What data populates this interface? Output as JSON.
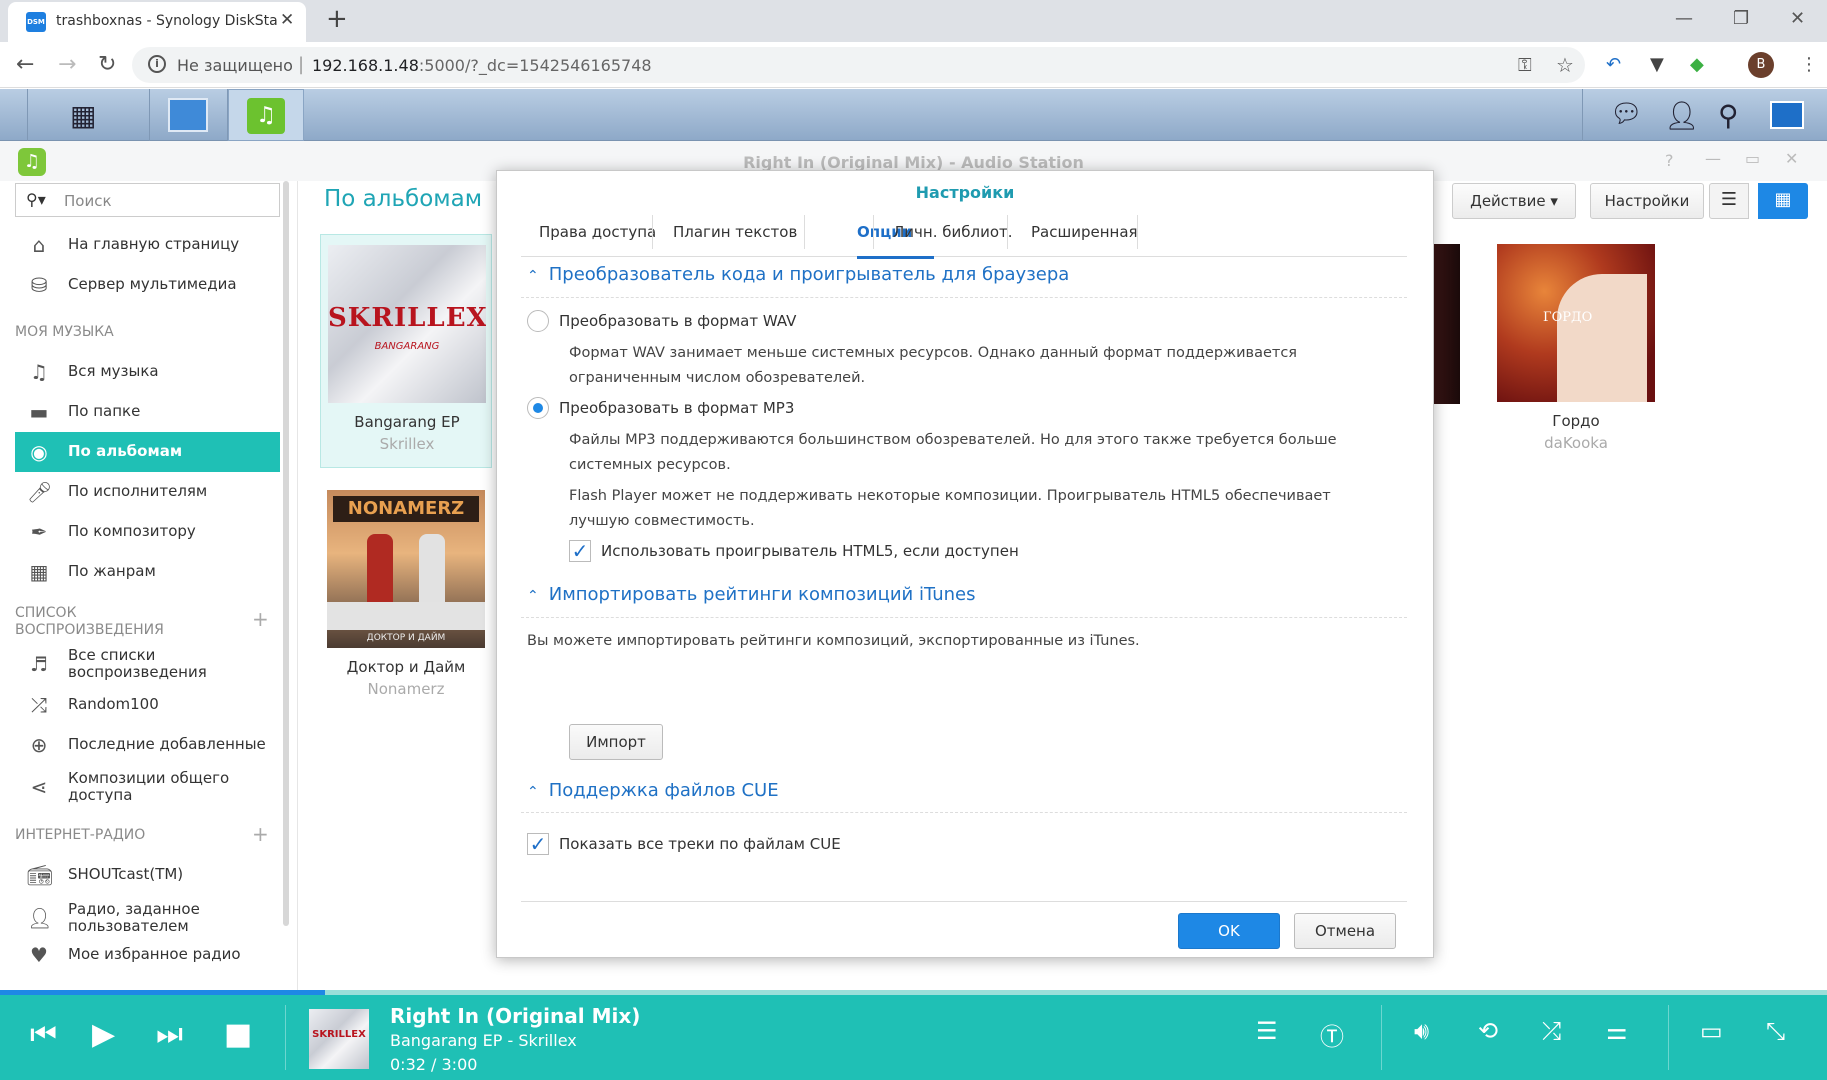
{
  "browser": {
    "tab_title": "trashboxnas - Synology DiskStation",
    "tab_favicon": "DSM",
    "security_label": "Не защищено",
    "url_host": "192.168.1.48",
    "url_rest": ":5000/?_dc=1542546165748",
    "avatar_letter": "B"
  },
  "window": {
    "title": "Right In (Original Mix) - Audio Station"
  },
  "sidebar": {
    "search_placeholder": "Поиск",
    "items_top": [
      {
        "label": "На главную страницу",
        "icon": "home-icon"
      },
      {
        "label": "Сервер мультимедиа",
        "icon": "media-server-icon"
      }
    ],
    "my_music_header": "МОЯ МУЗЫКА",
    "my_music": [
      {
        "label": "Вся музыка",
        "icon": "music-note-icon"
      },
      {
        "label": "По папке",
        "icon": "folder-icon"
      },
      {
        "label": "По альбомам",
        "icon": "disc-icon",
        "active": true
      },
      {
        "label": "По исполнителям",
        "icon": "microphone-icon"
      },
      {
        "label": "По композитору",
        "icon": "pen-icon"
      },
      {
        "label": "По жанрам",
        "icon": "genre-grid-icon"
      }
    ],
    "playlist_header_1": "СПИСОК",
    "playlist_header_2": "ВОСПРОИЗВЕДЕНИЯ",
    "playlists": [
      {
        "label": "Все списки воспроизведения",
        "icon": "playlist-icon"
      },
      {
        "label": "Random100",
        "icon": "shuffle-icon"
      },
      {
        "label": "Последние добавленные",
        "icon": "plus-circle-icon"
      },
      {
        "label": "Композиции общего доступа",
        "icon": "share-icon"
      }
    ],
    "radio_header": "ИНТЕРНЕТ-РАДИО",
    "radio": [
      {
        "label": "SHOUTcast(TM)",
        "icon": "radio-icon"
      },
      {
        "label": "Радио, заданное пользователем",
        "icon": "user-icon"
      },
      {
        "label": "Мое избранное радио",
        "icon": "heart-icon"
      }
    ]
  },
  "main": {
    "page_title": "По альбомам",
    "action_button": "Действие",
    "settings_button": "Настройки",
    "albums": [
      {
        "name": "Bangarang EP",
        "artist": "Skrillex"
      },
      {
        "name": "Доктор и Дайм",
        "artist": "Nonamerz"
      },
      {
        "name": "Гордо",
        "artist": "daKooka"
      }
    ],
    "cover_texts": {
      "skrillex": "SKRILLEX",
      "bangarang": "BANGARANG",
      "nonamerz": "NONAMERZ",
      "nonamerz_sub": "ДОКТОР И ДАЙМ",
      "gordo": "ГОРДО"
    }
  },
  "dialog": {
    "title": "Настройки",
    "tabs": [
      "Права доступа",
      "Плагин текстов",
      "Опции",
      "Личн. библиот.",
      "Расширенная"
    ],
    "active_tab": "Опции",
    "section1_title": "Преобразователь кода и проигрыватель для браузера",
    "wav_label": "Преобразовать в формат WAV",
    "wav_desc_1": "Формат WAV занимает меньше системных ресурсов. Однако данный формат поддерживается",
    "wav_desc_2": "ограниченным числом обозревателей.",
    "mp3_label": "Преобразовать в формат MP3",
    "mp3_desc_1": "Файлы MP3 поддерживаются большинством обозревателей. Но для этого также требуется больше",
    "mp3_desc_2": "системных ресурсов.",
    "flash_desc_1": "Flash Player может не поддерживать некоторые композиции. Проигрыватель HTML5 обеспечивает",
    "flash_desc_2": "лучшую совместимость.",
    "html5_label": "Использовать проигрыватель HTML5, если доступен",
    "selected_format": "MP3",
    "html5_checked": true,
    "section2_title": "Импортировать рейтинги композиций iTunes",
    "itunes_desc": "Вы можете импортировать рейтинги композиций, экспортированные из iTunes.",
    "import_button": "Импорт",
    "section3_title": "Поддержка файлов CUE",
    "cue_label": "Показать все треки по файлам CUE",
    "cue_checked": true,
    "ok_button": "OK",
    "cancel_button": "Отмена"
  },
  "player": {
    "title": "Right In (Original Mix)",
    "subtitle": "Bangarang EP - Skrillex",
    "time": "0:32 / 3:00",
    "progress": 0.178
  },
  "colors": {
    "accent": "#1fc0b5",
    "link_blue": "#1f71c5",
    "primary_button": "#1e88e5"
  }
}
